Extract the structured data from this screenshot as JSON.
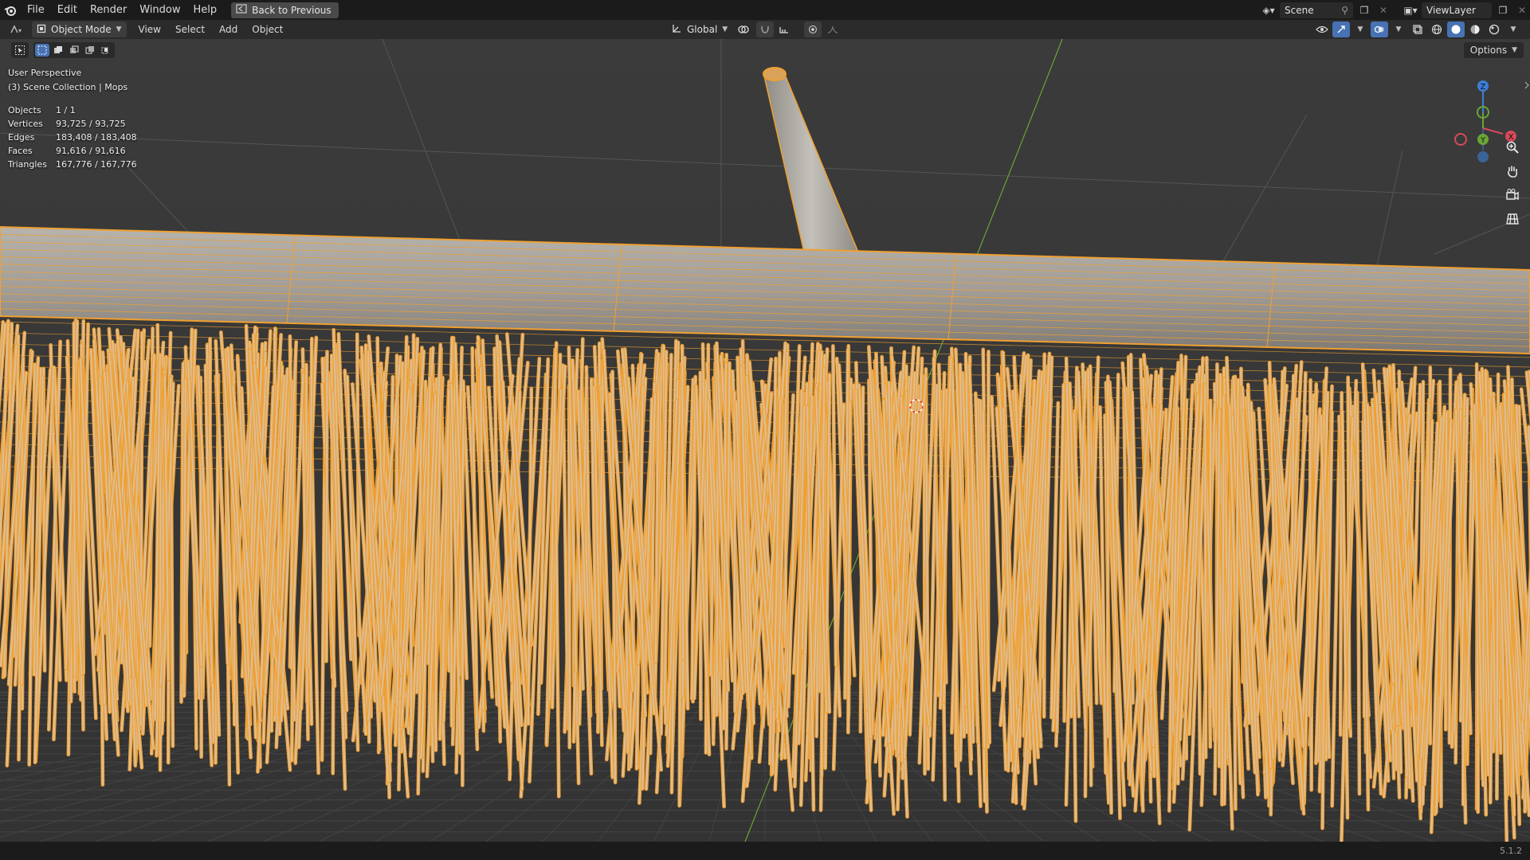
{
  "topbar": {
    "menus": [
      "File",
      "Edit",
      "Render",
      "Window",
      "Help"
    ],
    "back_label": "Back to Previous",
    "scene_name": "Scene",
    "view_layer": "ViewLayer"
  },
  "viewport_header": {
    "mode_label": "Object Mode",
    "menus": [
      "View",
      "Select",
      "Add",
      "Object"
    ],
    "orientation_label": "Global"
  },
  "overlay": {
    "view_name": "User Perspective",
    "collection": "(3) Scene Collection | Mops",
    "stats": [
      {
        "label": "Objects",
        "value": "1 / 1"
      },
      {
        "label": "Vertices",
        "value": "93,725 / 93,725"
      },
      {
        "label": "Edges",
        "value": "183,408 / 183,408"
      },
      {
        "label": "Faces",
        "value": "91,616 / 91,616"
      },
      {
        "label": "Triangles",
        "value": "167,776 / 167,776"
      }
    ]
  },
  "options_label": "Options",
  "gizmo": {
    "z": "Z",
    "y": "Y",
    "x": "X"
  },
  "status": {
    "version": "5.1.2"
  },
  "icons": [
    "blender-logo-icon",
    "back-icon",
    "scene-icon",
    "pin-icon",
    "new-scene-icon",
    "view-layer-icon",
    "editor-type-icon",
    "object-mode-icon",
    "transform-orientation-icon",
    "pivot-icon",
    "snap-icon",
    "proportional-edit-icon",
    "select-box-icon",
    "zoom-icon",
    "hand-pan-icon",
    "camera-icon",
    "grid-ortho-icon",
    "wireframe-shading-icon",
    "solid-shading-icon",
    "material-shading-icon",
    "rendered-shading-icon"
  ],
  "colors": {
    "selection": "#f0a030",
    "topbar": "#1b1b1b",
    "header": "#2b2b2b",
    "viewport": "#3a3a3a",
    "accent": "#4772b3"
  }
}
